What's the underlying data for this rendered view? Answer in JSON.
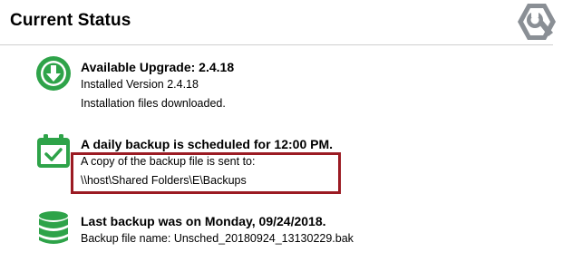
{
  "header": {
    "title": "Current Status"
  },
  "logo": {
    "icon": "wrench-gear-logo-icon"
  },
  "colors": {
    "icon_green": "#2ea349",
    "highlight_border": "#9b1b23",
    "logo_gray": "#8a8f95"
  },
  "items": [
    {
      "icon": "download-icon",
      "headline": "Available Upgrade: 2.4.18",
      "lines": [
        "Installed Version 2.4.18",
        "Installation files downloaded."
      ]
    },
    {
      "icon": "calendar-check-icon",
      "headline": "A daily backup is scheduled for 12:00 PM.",
      "lines": [
        "A copy of the backup file is sent to:",
        "\\\\host\\Shared Folders\\E\\Backups"
      ]
    },
    {
      "icon": "database-icon",
      "headline": "Last backup was on Monday, 09/24/2018.",
      "lines": [
        "Backup file name: Unsched_20180924_13130229.bak"
      ]
    }
  ]
}
